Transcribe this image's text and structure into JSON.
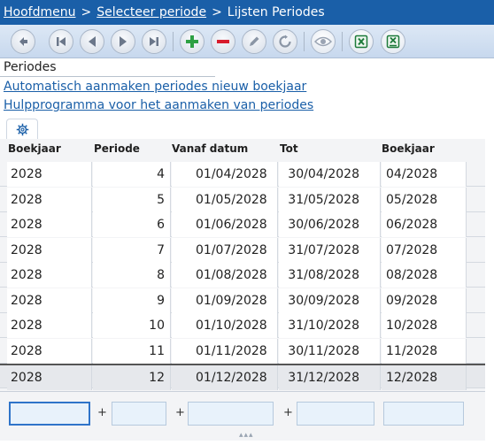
{
  "breadcrumb": {
    "items": [
      "Hoofdmenu",
      "Selecteer periode"
    ],
    "separator": ">",
    "current": "Lijsten Periodes"
  },
  "toolbar": {
    "buttons": [
      {
        "name": "back-icon"
      },
      {
        "name": "first-record-icon"
      },
      {
        "name": "previous-record-icon"
      },
      {
        "name": "next-record-icon"
      },
      {
        "name": "last-record-icon"
      },
      {
        "name": "add-icon"
      },
      {
        "name": "delete-icon"
      },
      {
        "name": "edit-icon"
      },
      {
        "name": "refresh-icon"
      },
      {
        "name": "view-icon"
      },
      {
        "name": "excel-export-icon"
      },
      {
        "name": "excel-import-icon"
      }
    ],
    "colors": {
      "add": "#2ea043",
      "delete": "#d81b2b",
      "excel": "#1d7a3a"
    }
  },
  "section": {
    "title": "Periodes",
    "links": [
      "Automatisch aanmaken periodes nieuw boekjaar",
      "Hulpprogramma voor het aanmaken van periodes"
    ]
  },
  "grid": {
    "columns": [
      "Boekjaar",
      "Periode",
      "Vanaf datum",
      "Tot",
      "Boekjaar"
    ],
    "rows": [
      [
        "2028",
        "4",
        "01/04/2028",
        "30/04/2028",
        "04/2028"
      ],
      [
        "2028",
        "5",
        "01/05/2028",
        "31/05/2028",
        "05/2028"
      ],
      [
        "2028",
        "6",
        "01/06/2028",
        "30/06/2028",
        "06/2028"
      ],
      [
        "2028",
        "7",
        "01/07/2028",
        "31/07/2028",
        "07/2028"
      ],
      [
        "2028",
        "8",
        "01/08/2028",
        "31/08/2028",
        "08/2028"
      ],
      [
        "2028",
        "9",
        "01/09/2028",
        "30/09/2028",
        "09/2028"
      ],
      [
        "2028",
        "10",
        "01/10/2028",
        "31/10/2028",
        "10/2028"
      ],
      [
        "2028",
        "11",
        "01/11/2028",
        "30/11/2028",
        "11/2028"
      ],
      [
        "2028",
        "12",
        "01/12/2028",
        "31/12/2028",
        "12/2028"
      ]
    ],
    "selected_row": 8
  },
  "footer": {
    "plus_label": "+"
  }
}
